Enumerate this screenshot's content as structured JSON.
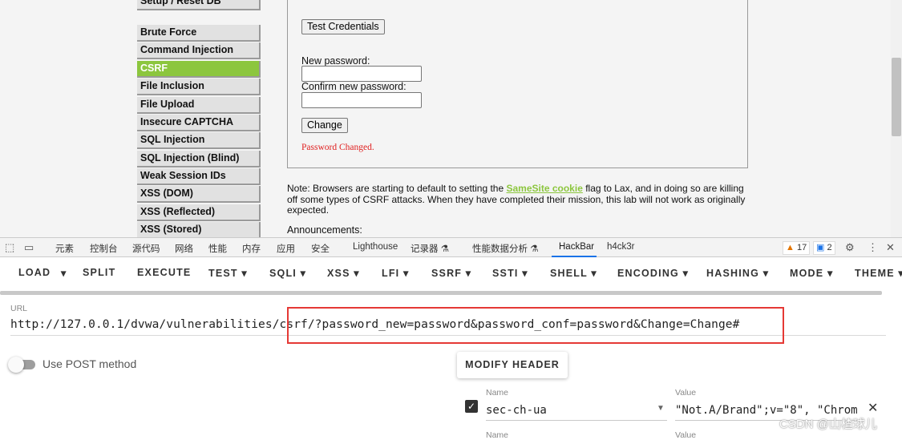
{
  "menu": {
    "items": [
      {
        "label": "Setup / Reset DB",
        "active": false
      },
      {
        "label": "Brute Force",
        "active": false
      },
      {
        "label": "Command Injection",
        "active": false
      },
      {
        "label": "CSRF",
        "active": true
      },
      {
        "label": "File Inclusion",
        "active": false
      },
      {
        "label": "File Upload",
        "active": false
      },
      {
        "label": "Insecure CAPTCHA",
        "active": false
      },
      {
        "label": "SQL Injection",
        "active": false
      },
      {
        "label": "SQL Injection (Blind)",
        "active": false
      },
      {
        "label": "Weak Session IDs",
        "active": false
      },
      {
        "label": "XSS (DOM)",
        "active": false
      },
      {
        "label": "XSS (Reflected)",
        "active": false
      },
      {
        "label": "XSS (Stored)",
        "active": false
      }
    ]
  },
  "csrf_form": {
    "test_credentials_label": "Test Credentials",
    "new_password_label": "New password:",
    "confirm_password_label": "Confirm new password:",
    "change_label": "Change",
    "result_message": "Password Changed."
  },
  "note": {
    "prefix": "Note: Browsers are starting to default to setting the ",
    "link_text": "SameSite cookie",
    "suffix": " flag to Lax, and in doing so are killing off some types of CSRF attacks. When they have completed their mission, this lab will not work as originally expected.",
    "announcements": "Announcements:"
  },
  "devtools": {
    "tabs": [
      "元素",
      "控制台",
      "源代码",
      "网络",
      "性能",
      "内存",
      "应用",
      "安全",
      "Lighthouse",
      "记录器 ⚗",
      "性能数据分析 ⚗",
      "HackBar",
      "h4ck3r"
    ],
    "active_tab": "HackBar",
    "warnings_count": "17",
    "messages_count": "2"
  },
  "hackbar": {
    "toolbar": [
      {
        "label": "LOAD",
        "caret": false
      },
      {
        "label": "▾",
        "caret": false
      },
      {
        "label": "SPLIT",
        "caret": false
      },
      {
        "label": "EXECUTE",
        "caret": false
      },
      {
        "label": "TEST ▾",
        "caret": true
      },
      {
        "label": "SQLI ▾",
        "caret": true
      },
      {
        "label": "XSS ▾",
        "caret": true
      },
      {
        "label": "LFI ▾",
        "caret": true
      },
      {
        "label": "SSRF ▾",
        "caret": true
      },
      {
        "label": "SSTI ▾",
        "caret": true
      },
      {
        "label": "SHELL ▾",
        "caret": true
      },
      {
        "label": "ENCODING ▾",
        "caret": true
      },
      {
        "label": "HASHING ▾",
        "caret": true
      },
      {
        "label": "MODE ▾",
        "caret": true
      },
      {
        "label": "THEME ▾",
        "caret": true
      }
    ],
    "url_label": "URL",
    "url_value": "http://127.0.0.1/dvwa/vulnerabilities/csrf/?password_new=password&password_conf=password&Change=Change#",
    "post_method_label": "Use POST method",
    "modify_header_label": "MODIFY HEADER",
    "headers": [
      {
        "name_label": "Name",
        "name": "sec-ch-ua",
        "value_label": "Value",
        "value": "\"Not.A/Brand\";v=\"8\", \"Chrom",
        "checked": true
      },
      {
        "name_label": "Name",
        "name": "",
        "value_label": "Value",
        "value": "",
        "checked": false
      }
    ]
  },
  "watermark": "CSDN @山楂球儿"
}
